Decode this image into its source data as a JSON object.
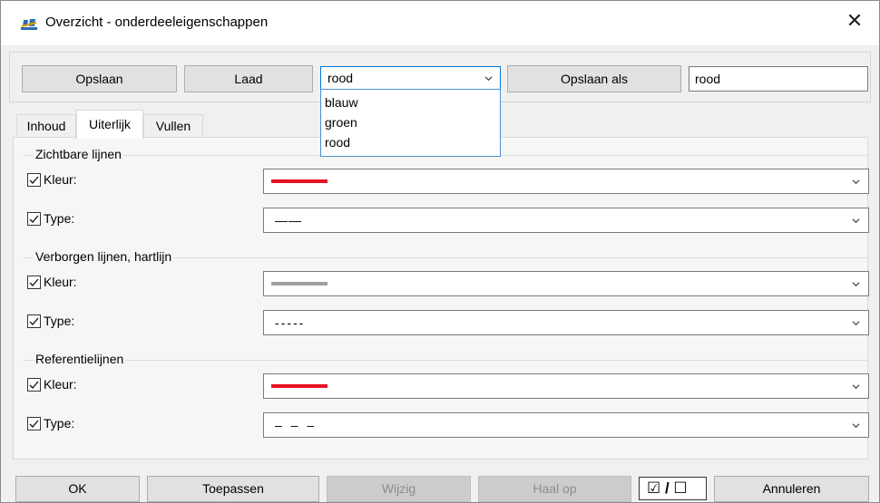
{
  "window": {
    "title": "Overzicht - onderdeeleigenschappen",
    "close_glyph": "✕"
  },
  "toolbar": {
    "save_label": "Opslaan",
    "load_label": "Laad",
    "preset_selected": "rood",
    "save_as_label": "Opslaan als",
    "save_as_value": "rood"
  },
  "preset_options": [
    "blauw",
    "groen",
    "rood"
  ],
  "tabs": [
    "Inhoud",
    "Uiterlijk",
    "Vullen"
  ],
  "active_tab": "Uiterlijk",
  "sections": [
    {
      "title": "Zichtbare lijnen",
      "color_label": "Kleur:",
      "color_hex": "#e81123",
      "type_label": "Type:",
      "type_value": "——"
    },
    {
      "title": "Verborgen lijnen, hartlijn",
      "color_label": "Kleur:",
      "color_hex": "#a0a0a0",
      "type_label": "Type:",
      "type_value": "-----"
    },
    {
      "title": "Referentielijnen",
      "color_label": "Kleur:",
      "color_hex": "#e81123",
      "type_label": "Type:",
      "type_value": "– – –"
    }
  ],
  "footer": {
    "ok_label": "OK",
    "apply_label": "Toepassen",
    "modify_label": "Wijzig",
    "fetch_label": "Haal op",
    "toggle_label": "☑ / ☐",
    "cancel_label": "Annuleren"
  }
}
